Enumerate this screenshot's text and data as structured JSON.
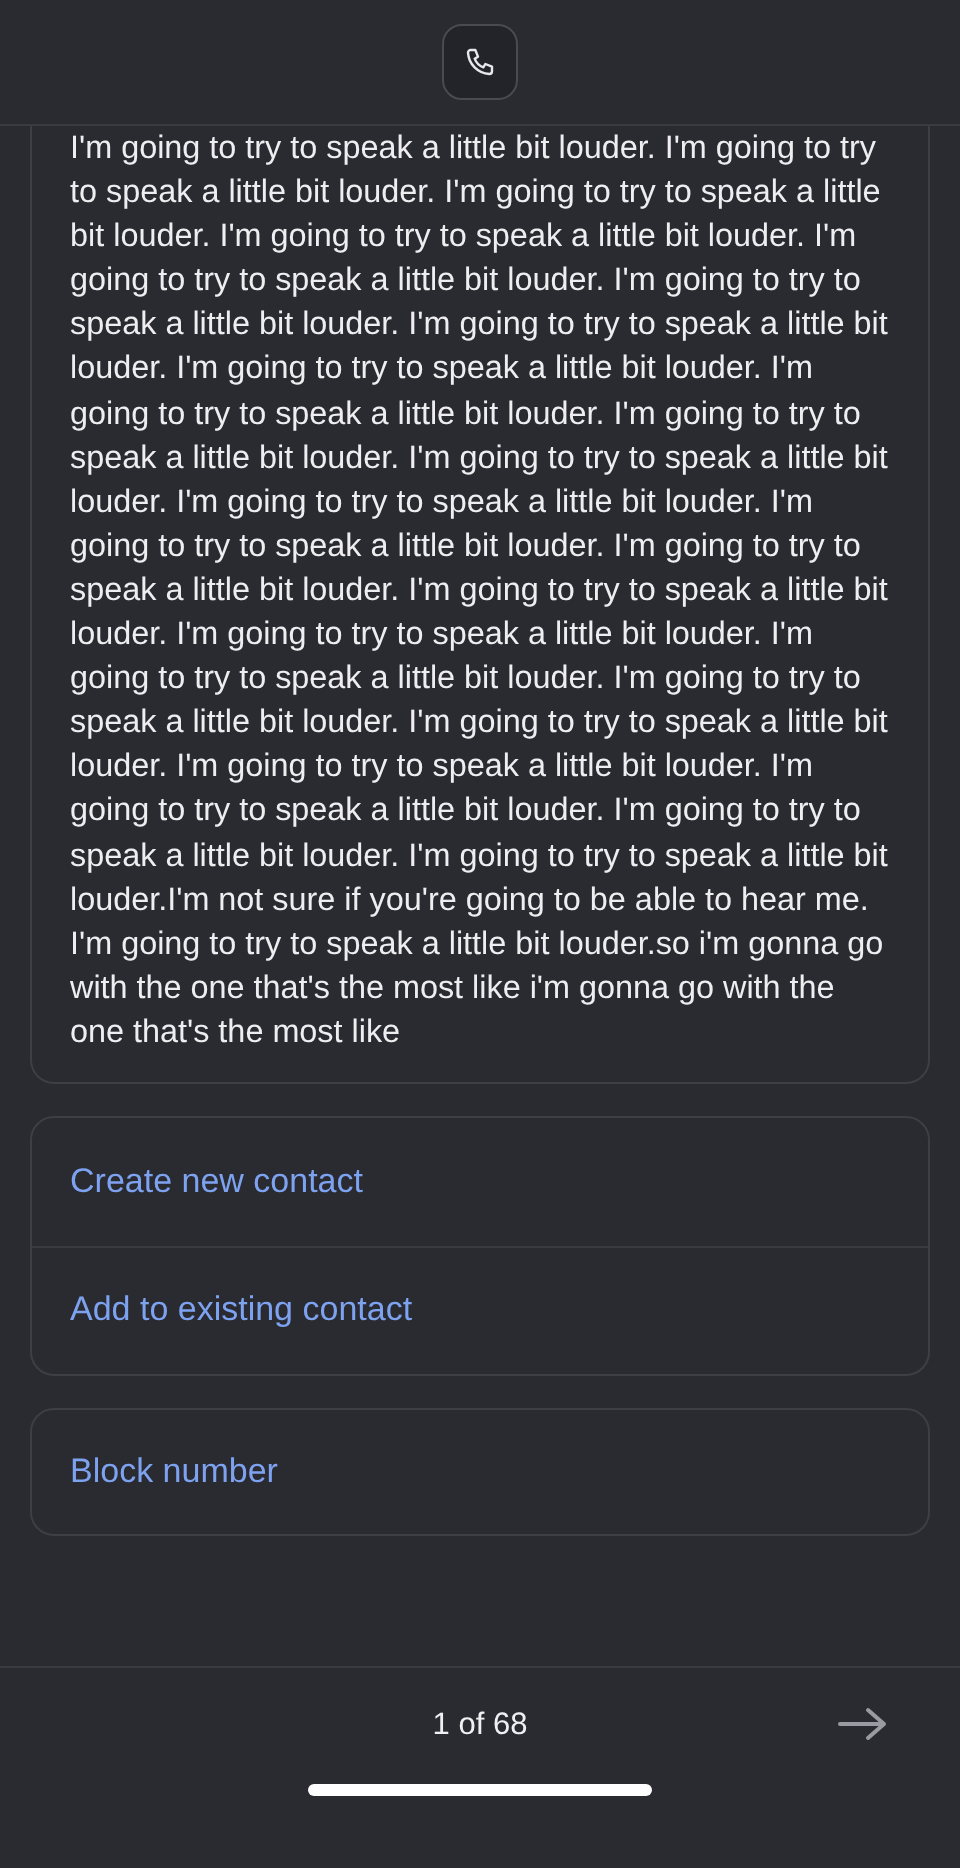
{
  "header": {
    "kind": "call"
  },
  "transcript": {
    "text": "I'm going to try to speak a little bit louder. I'm going to try to speak a little bit louder. I'm going to try to speak a little bit louder. I'm going to try to speak a little bit louder. I'm going to try to speak a little bit louder. I'm going to try to speak a little bit louder. I'm going to try to speak a little bit louder. I'm going to try to speak a little bit louder. I'm going to try to speak a little bit louder. I'm going to try to speak a little bit louder. I'm going to try to speak a little bit louder. I'm going to try to speak a little bit louder. I'm going to try to speak a little bit louder. I'm going to try to speak a little bit louder. I'm going to try to speak a little bit louder. I'm going to try to speak a little bit louder. I'm going to try to speak a little bit louder. I'm going to try to speak a little bit louder. I'm going to try to speak a little bit louder. I'm going to try to speak a little bit louder. I'm going to try to speak a little bit louder. I'm going to try to speak a little bit louder. I'm going to try to speak a little bit louder.I'm not sure if you're going to be able to hear me. I'm going to try to speak a little bit louder.so i'm gonna go with the one that's the most like i'm gonna go with the one that's the most like"
  },
  "action_groups": [
    {
      "actions": [
        "Create new contact",
        "Add to existing contact"
      ]
    },
    {
      "actions": [
        "Block number"
      ]
    }
  ],
  "footer": {
    "pager": "1 of 68"
  }
}
